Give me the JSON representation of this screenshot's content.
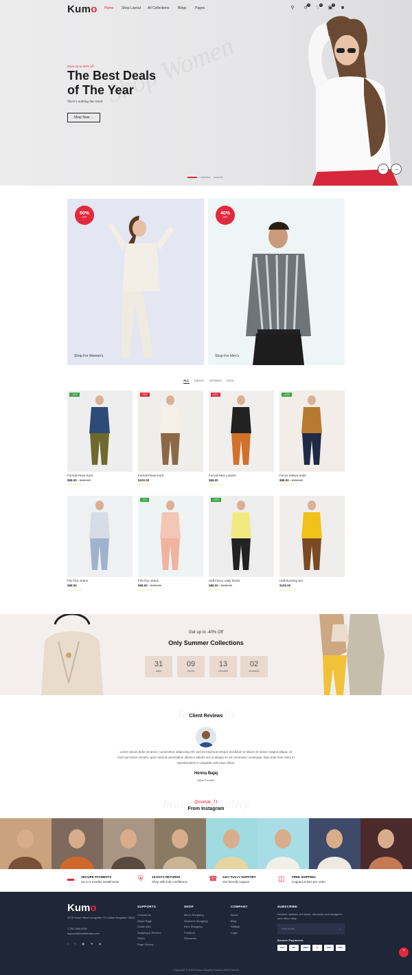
{
  "header": {
    "logo_main": "Kum",
    "logo_accent": "o",
    "nav": [
      "Home",
      "Shop Layout",
      "All Collections",
      "Blogs",
      "Pages"
    ],
    "wishlist_count": "0",
    "cart_count": "0",
    "compare_count": "0"
  },
  "hero": {
    "promo": "Save up to 60% off",
    "title_line1": "The Best Deals",
    "title_line2": "of The Year",
    "subtitle": "There's nothing like trend",
    "button": "Shop Now →",
    "watermark": "Shop Women"
  },
  "promos": [
    {
      "badge_value": "50%",
      "badge_label": "OFF",
      "link": "Shop For Women's"
    },
    {
      "badge_value": "40%",
      "badge_label": "OFF",
      "link": "Shop For Men's"
    }
  ],
  "tabs": [
    "ALL",
    "MEN'S",
    "WOMEN",
    "KIDS"
  ],
  "products": [
    {
      "name": "Formal Fluee Kurti",
      "price": "$88.00",
      "old_price": "$100.00",
      "tag": "-12%",
      "tag_color": "#3aa546"
    },
    {
      "name": "Formal Fluee Kurti",
      "price": "$100.00",
      "old_price": "",
      "tag": "HOT",
      "tag_color": "#e2293d"
    },
    {
      "name": "Formal Men Lowers",
      "price": "$88.00",
      "old_price": "",
      "tag": "HOT",
      "tag_color": "#e2293d"
    },
    {
      "name": "Fancy Salwar Suits",
      "price": "$88.00",
      "old_price": "$100.00",
      "tag": "-12%",
      "tag_color": "#3aa546"
    },
    {
      "name": "Flix Flox Jeans",
      "price": "$88.00",
      "old_price": "",
      "tag": "",
      "tag_color": ""
    },
    {
      "name": "Flix Flox Jeans",
      "price": "$98.00",
      "old_price": "$100.00",
      "tag": "-2%",
      "tag_color": "#3aa546"
    },
    {
      "name": "Half Fancy Lady Dress",
      "price": "$88.00",
      "old_price": "$100.00",
      "tag": "-12%",
      "tag_color": "#3aa546"
    },
    {
      "name": "Half Running Set",
      "price": "$100.00",
      "old_price": "",
      "tag": "",
      "tag_color": ""
    }
  ],
  "stars": "☆☆☆☆☆",
  "summer": {
    "pre": "Get up to -40% Off",
    "title": "Only Summer Collections",
    "countdown": [
      {
        "value": "31",
        "label": "days"
      },
      {
        "value": "09",
        "label": "hours"
      },
      {
        "value": "13",
        "label": "minutes"
      },
      {
        "value": "02",
        "label": "seconds"
      }
    ]
  },
  "reviews": {
    "watermark": "Testimonials",
    "title": "Client Reviews",
    "text": "Lorem ipsum dolor sit amet, consectetur adipiscing elit, sed do eiusmod tempor incididunt ut labore et dolore magna aliqua. Ut enim ad minim veniam, quis nostrud exercitation ullamco laboris nisi ut aliquip ex ea commodo consequat. Duis aute irure dolor in reprehenderit in voluptate velit esse cillum.",
    "name": "Henna Bajaj",
    "role": "Aqua Founder"
  },
  "instagram": {
    "watermark": "Instagram Gallery",
    "handle": "@mahak_71",
    "title": "From Instagram"
  },
  "features": [
    {
      "title": "SECURE PAYMENTS",
      "subtitle": "Up to 6 months installments",
      "icon": "card-icon"
    },
    {
      "title": "15-DAYS RETURNS",
      "subtitle": "Shop with fully confidence",
      "icon": "shield-icon"
    },
    {
      "title": "24X7 FULLY SUPPORT",
      "subtitle": "Get friendly support",
      "icon": "headset-icon"
    },
    {
      "title": "FREE SHIPPING",
      "subtitle": "Capped at $10 per order",
      "icon": "basket-icon"
    }
  ],
  "footer": {
    "logo_main": "Kum",
    "logo_accent": "o",
    "address": "2076 Grant Street Longview, TX United Kingdom 75601",
    "phone": "1-202-555-0105",
    "email": "support@kutethemes.com",
    "columns": [
      {
        "title": "SUPPORTS",
        "links": [
          "Contact Us",
          "About Page",
          "Guide Size",
          "Shipping & Returns",
          "FAQ's",
          "Page Privacy"
        ]
      },
      {
        "title": "SHOP",
        "links": [
          "Men's Shopping",
          "Women's Shopping",
          "Kid's Shopping",
          "Furniture",
          "Discounts"
        ]
      },
      {
        "title": "COMPANY",
        "links": [
          "About",
          "Blog",
          "Affiliate",
          "Login"
        ]
      }
    ],
    "subscribe_title": "SUBSCRIBE",
    "subscribe_text": "Receive updates, hot deals, discounts sent straight in your inbox daily",
    "email_placeholder": "Your email",
    "payments_title": "Secure Payments",
    "payment_cards": [
      "VISA",
      "MC",
      "AMEX",
      "P",
      "VISA",
      "DISC"
    ],
    "copyright": "Copyright © 2023 Kuma Shopify Fashion 2023 Theme"
  }
}
